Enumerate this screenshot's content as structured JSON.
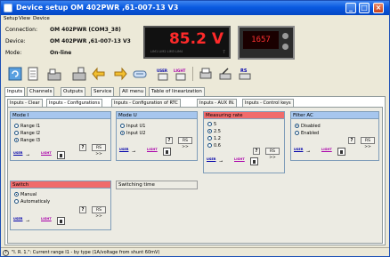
{
  "window": {
    "title": "Device setup OM 402PWR ,61-007-13 V3"
  },
  "menu": {
    "setup": "Setup",
    "view": "View",
    "device": "Device"
  },
  "info": {
    "connection_label": "Connection:",
    "connection_value": "OM 402PWR (COM3_38)",
    "device_label": "Device:",
    "device_value": "OM 402PWR ,61-007-13 V3",
    "mode_label": "Mode:",
    "mode_value": "On-line"
  },
  "display": {
    "value": "85.2 V",
    "leds": "LIM1   LIM2   LIM3   LIM4",
    "t_label": "T",
    "photo_value": "1657"
  },
  "tabs": [
    "Inputs",
    "Channels",
    "Outputs",
    "Service",
    "All menu",
    "Table of linearization"
  ],
  "subtabs": [
    "Inputs - Clear",
    "Inputs - Configurations",
    "Inputs - Configuration of RTC",
    "Inputs - AUX IN.",
    "Inputs - Control keys"
  ],
  "groups": {
    "mode_i": {
      "title": "Mode I",
      "options": [
        "Range I1",
        "Range I2",
        "Range I3"
      ],
      "selected": 2
    },
    "mode_u": {
      "title": "Mode U",
      "options": [
        "Input U1",
        "Input U2"
      ],
      "selected": 1
    },
    "rate": {
      "title": "Measuring rate",
      "options": [
        "5",
        "2.5",
        "1.2",
        "0.6"
      ],
      "selected": 1
    },
    "filter": {
      "title": "Filter AC",
      "options": [
        "Disabled",
        "Enabled"
      ],
      "selected": 0
    },
    "switch": {
      "title": "Switch",
      "options": [
        "Manual",
        "Automaticaly"
      ],
      "selected": 0
    },
    "switching_time": {
      "title": "Switching time"
    }
  },
  "buttons": {
    "help": "?",
    "rs": "RS >>"
  },
  "access": {
    "user": "USER",
    "light": "LIGHT"
  },
  "status": {
    "text": "\"I. R. 1.\": Current range I1 - by type (1A/voltage from shunt 60mV)"
  }
}
